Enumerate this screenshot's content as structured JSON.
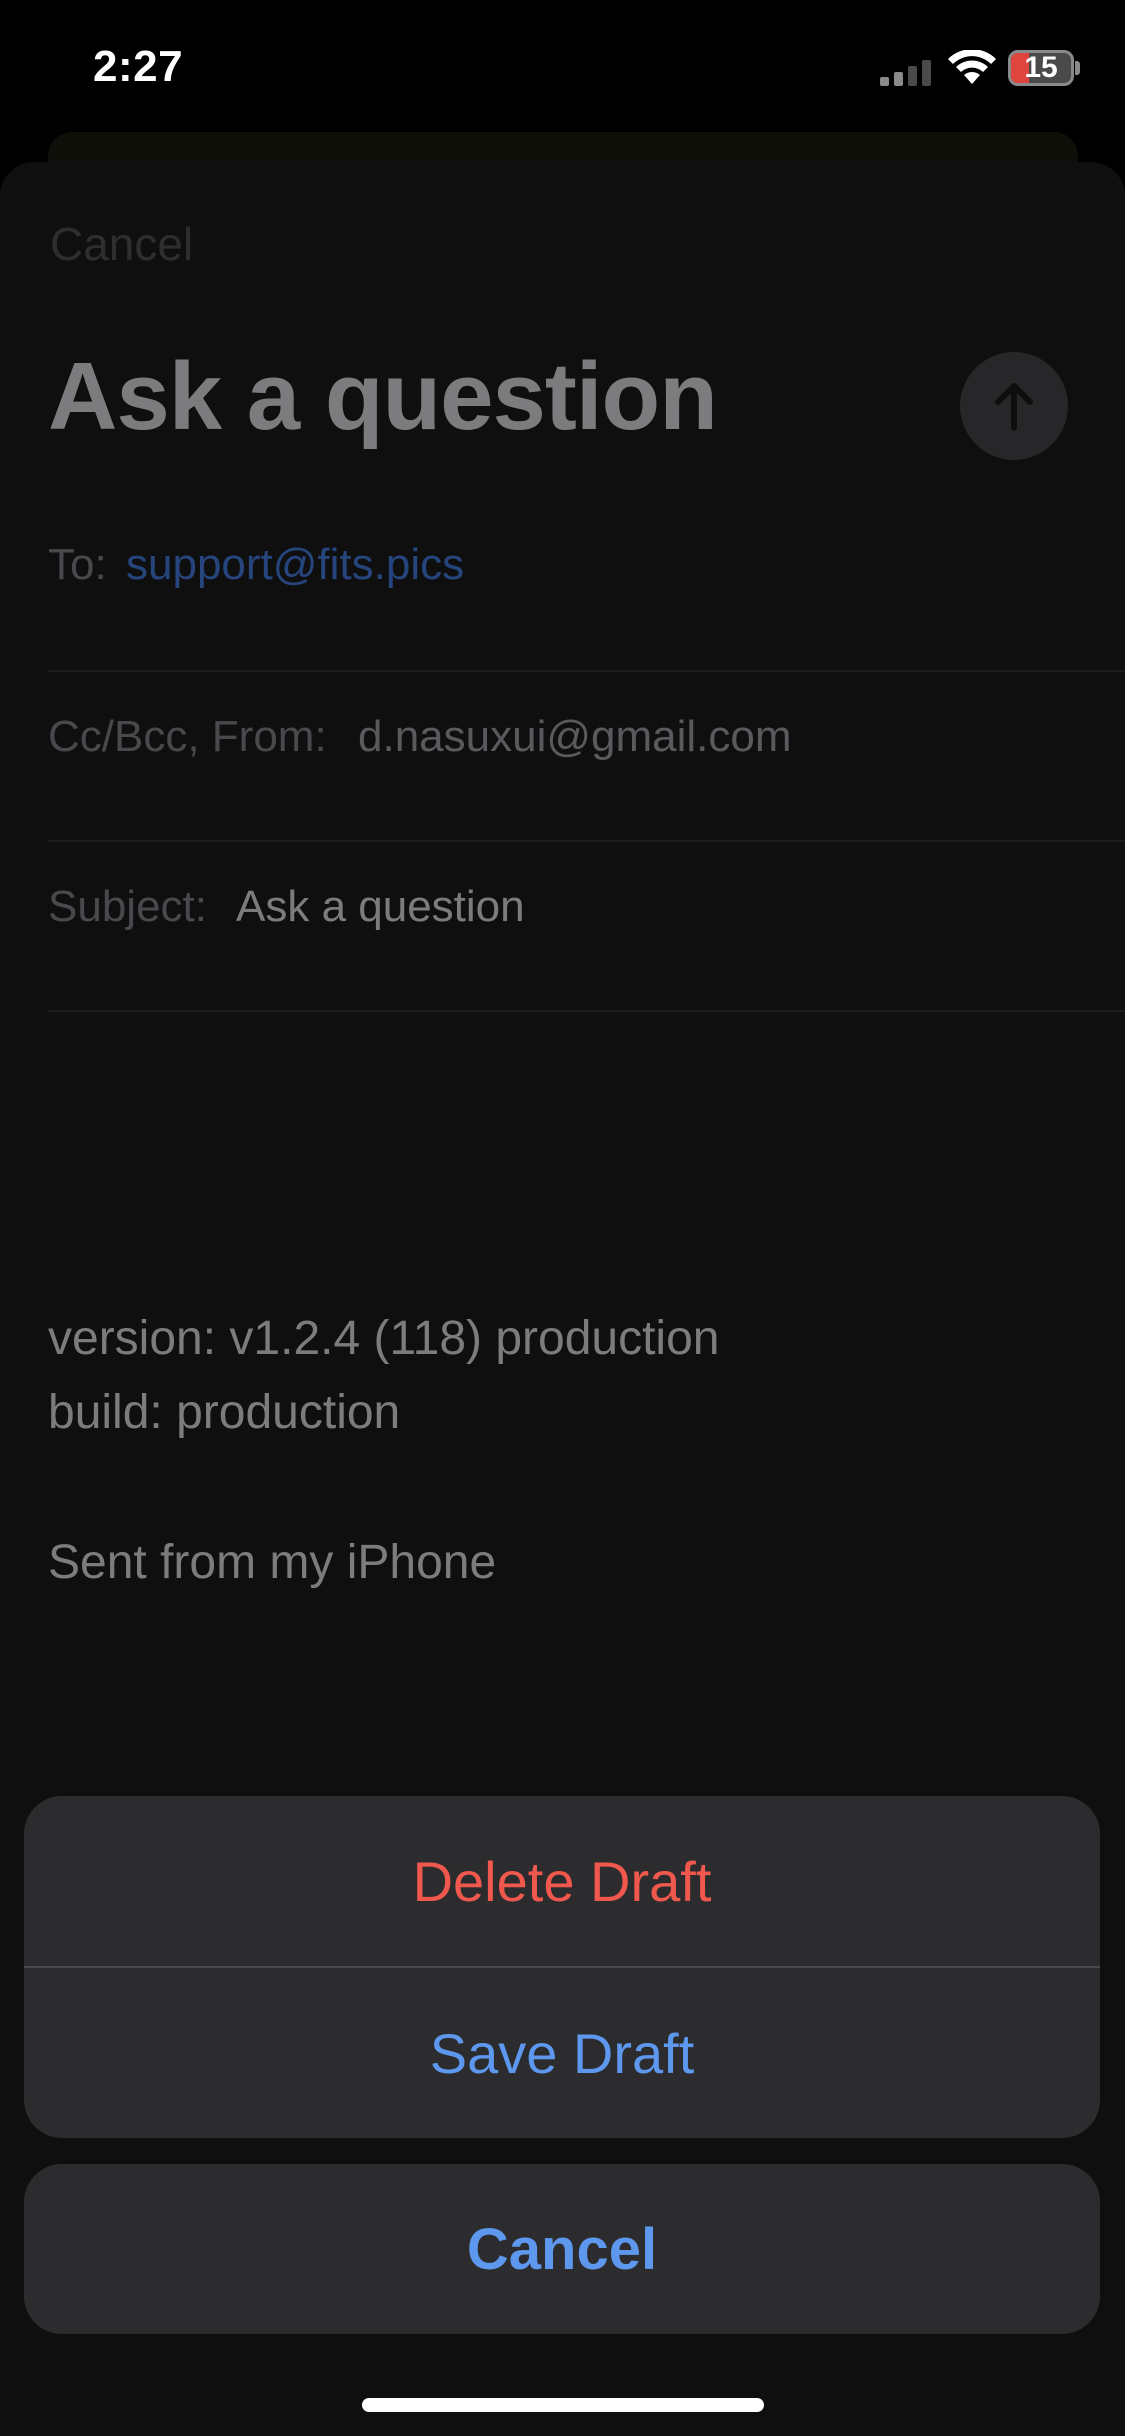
{
  "status_bar": {
    "time": "2:27",
    "battery_level": "15",
    "battery_percent": 15,
    "battery_color": "#e0443e",
    "icons": [
      "signal-icon",
      "wifi-icon",
      "battery-icon"
    ]
  },
  "compose": {
    "cancel_label": "Cancel",
    "title": "Ask a question",
    "send_icon": "arrow-up-icon",
    "to_label": "To:",
    "to_value": "support@fits.pics",
    "cc_label": "Cc/Bcc, From:",
    "cc_value": "d.nasuxui@gmail.com",
    "subject_label": "Subject:",
    "subject_value": "Ask a question",
    "body": {
      "version_line": "version: v1.2.4 (118) production",
      "build_line": "build: production",
      "signature": "Sent from my iPhone"
    }
  },
  "action_sheet": {
    "delete_label": "Delete Draft",
    "save_label": "Save Draft",
    "cancel_label": "Cancel",
    "delete_color": "#f0584d",
    "accent_color": "#5d97ee"
  }
}
